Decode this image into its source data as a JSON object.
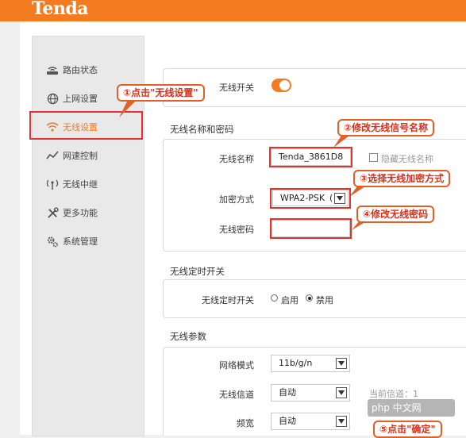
{
  "brand": {
    "logo": "Tenda"
  },
  "sidebar": {
    "items": [
      {
        "label": "路由状态",
        "icon": "router-icon"
      },
      {
        "label": "上网设置",
        "icon": "globe-icon"
      },
      {
        "label": "无线设置",
        "icon": "wifi-icon"
      },
      {
        "label": "网速控制",
        "icon": "speed-icon"
      },
      {
        "label": "无线中继",
        "icon": "antenna-icon"
      },
      {
        "label": "更多功能",
        "icon": "tools-icon"
      },
      {
        "label": "系统管理",
        "icon": "gears-icon"
      }
    ],
    "active_index": 2
  },
  "wireless_switch": {
    "label": "无线开关",
    "on": true
  },
  "ssid_section": {
    "title": "无线名称和密码",
    "ssid_label": "无线名称",
    "ssid_value": "Tenda_3861D8",
    "hide_label": "隐藏无线名称",
    "encryption_label": "加密方式",
    "encryption_value": "WPA2-PSK",
    "encryption_suffix": "(",
    "password_label": "无线密码",
    "password_value": ""
  },
  "timer_section": {
    "title": "无线定时开关",
    "label": "无线定时开关",
    "option_enable": "启用",
    "option_disable": "禁用",
    "selected": "禁用"
  },
  "params_section": {
    "title": "无线参数",
    "mode_label": "网络模式",
    "mode_value": "11b/g/n",
    "channel_label": "无线信道",
    "channel_value": "自动",
    "current_channel": "当前信道：1",
    "bandwidth_label": "频宽",
    "bandwidth_value": "自动"
  },
  "annotations": {
    "step1": "①点击\"无线设置\"",
    "step2": "②修改无线信号名称",
    "step3": "③选择无线加密方式",
    "step4": "④修改无线密码",
    "step5": "⑤点击\"确定\""
  },
  "watermark": "php 中文网",
  "colors": {
    "brand": "#f47b20",
    "highlight": "#e2322d",
    "callout_text": "#d6301d"
  }
}
